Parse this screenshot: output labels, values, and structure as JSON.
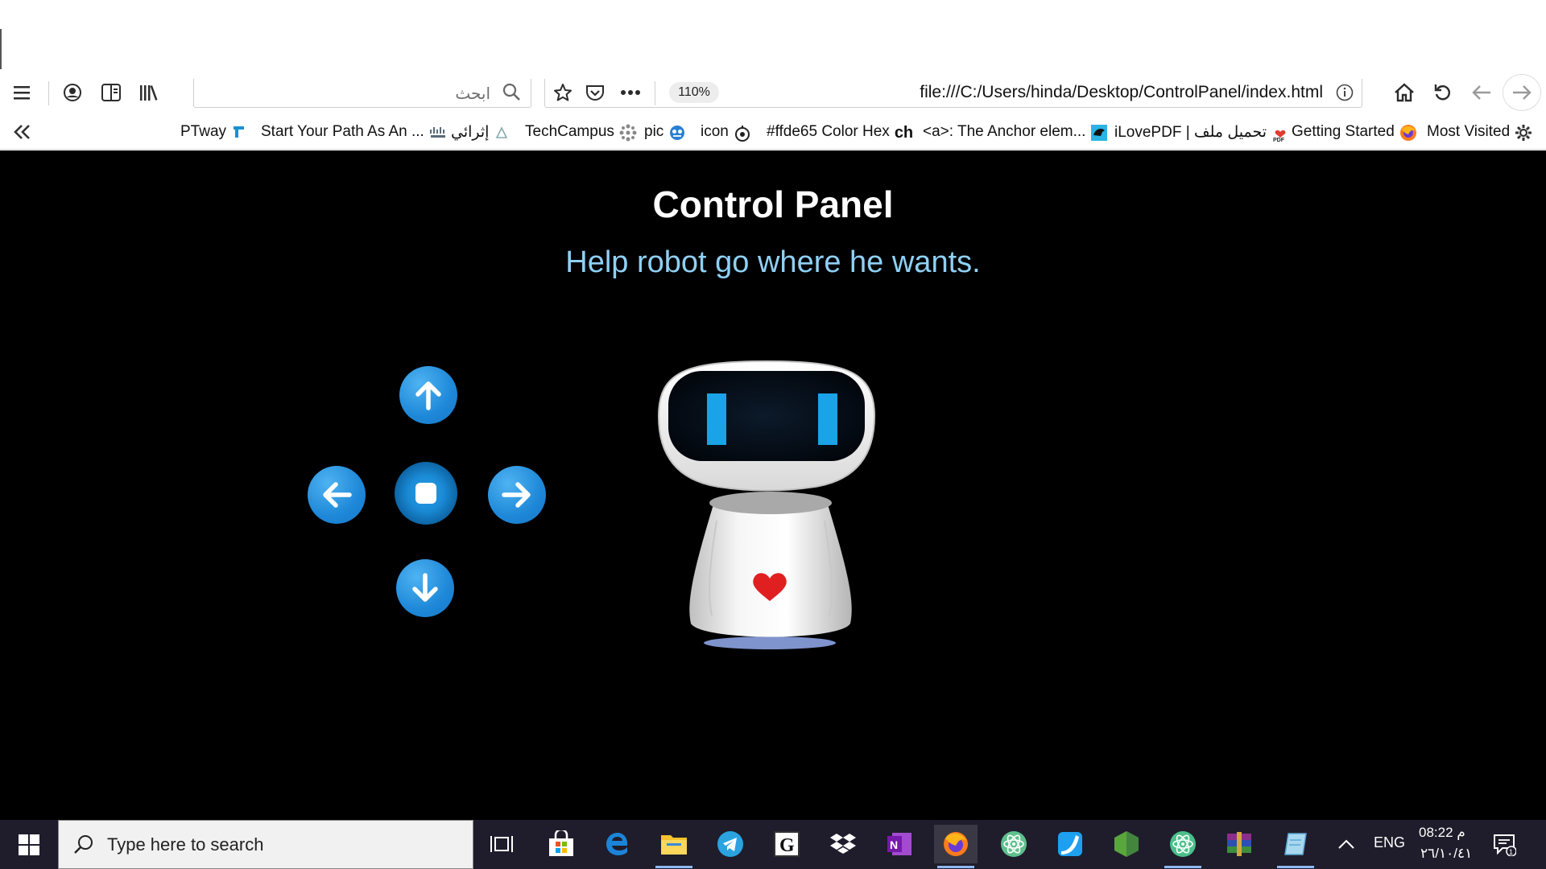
{
  "toolbar": {
    "menu_icon": "hamburger-menu-icon",
    "account_icon": "account-icon",
    "sidebar_icon": "reader-sidebar-icon",
    "library_icon": "library-icon",
    "search_placeholder": "ابحث",
    "bookmark_star_icon": "bookmark-star-icon",
    "pocket_icon": "pocket-icon",
    "more_icon": "more-dots-icon",
    "zoom_level": "110%",
    "url": "file:///C:/Users/hinda/Desktop/ControlPanel/index.html",
    "info_icon": "page-info-icon",
    "home_icon": "home-icon",
    "reload_icon": "reload-icon",
    "back_icon": "back-arrow-icon",
    "forward_icon": "forward-arrow-icon"
  },
  "bookmarks": {
    "collapse_icon": "double-chevron-left-icon",
    "items": [
      {
        "label": "PTway",
        "icon": "ptway-icon"
      },
      {
        "label": "Start Your Path As An ...",
        "icon": "cisco-icon"
      },
      {
        "label": "إثرائي",
        "icon": "ithraei-icon"
      },
      {
        "label": "TechCampus",
        "icon": "techcampus-icon"
      },
      {
        "label": "pic",
        "icon": "pic-icon"
      },
      {
        "label": "icon",
        "icon": "icon-site-icon"
      },
      {
        "label": "#ffde65 Color Hex",
        "icon": "colorhex-icon"
      },
      {
        "label": "<a>: The Anchor elem...",
        "icon": "mdn-icon"
      },
      {
        "label": "iLovePDF | تحميل ملف",
        "icon": "ilovepdf-icon"
      },
      {
        "label": "Getting Started",
        "icon": "firefox-icon"
      },
      {
        "label": "Most Visited",
        "icon": "gear-icon"
      }
    ]
  },
  "page": {
    "title": "Control Panel",
    "subtitle": "Help robot go where he wants.",
    "controls": {
      "up": "up-arrow-icon",
      "left": "left-arrow-icon",
      "stop": "stop-icon",
      "right": "right-arrow-icon",
      "down": "down-arrow-icon"
    },
    "colors": {
      "background": "#000000",
      "title": "#ffffff",
      "subtitle": "#8fd0f5",
      "button": "#1e88d8"
    }
  },
  "taskbar": {
    "search_placeholder": "Type here to search",
    "apps": [
      "task-view-icon",
      "store-icon",
      "edge-icon",
      "file-explorer-icon",
      "telegram-icon",
      "g-app-icon",
      "dropbox-icon",
      "onenote-icon",
      "firefox-icon",
      "atom-icon",
      "app-blue-icon",
      "nodejs-icon",
      "atom-icon-2",
      "winrar-icon",
      "notepad-icon"
    ],
    "language": "ENG",
    "time": "08:22 م",
    "date": "٢٦/١٠/٤١"
  }
}
